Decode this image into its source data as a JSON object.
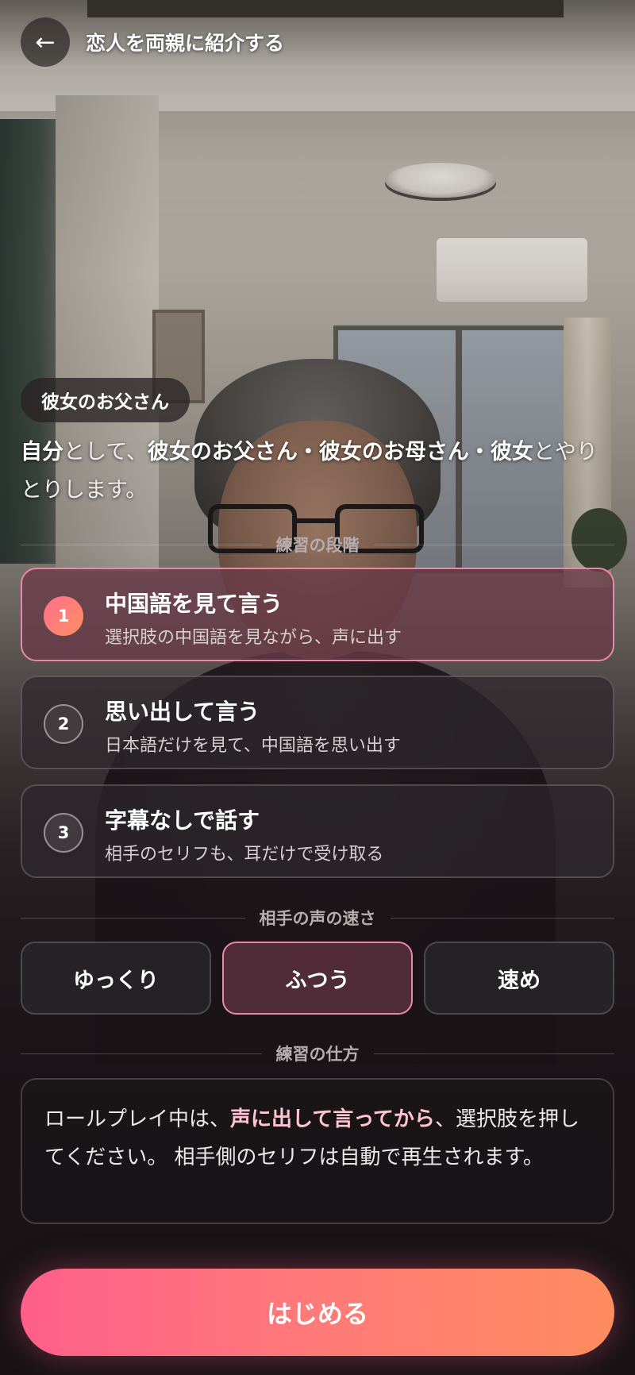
{
  "header": {
    "back_icon": "←",
    "title": "恋人を両親に紹介する"
  },
  "role_badge": "彼女のお父さん",
  "intro": {
    "self": "自分",
    "as": "として、",
    "partners": "彼女のお父さん・彼女のお母さん・彼女",
    "rest": "とやりとりします。"
  },
  "sections": {
    "steps_label": "練習の段階",
    "speed_label": "相手の声の速さ",
    "method_label": "練習の仕方"
  },
  "steps": [
    {
      "num": "1",
      "title": "中国語を見て言う",
      "subtitle": "選択肢の中国語を見ながら、声に出す",
      "selected": true
    },
    {
      "num": "2",
      "title": "思い出して言う",
      "subtitle": "日本語だけを見て、中国語を思い出す",
      "selected": false
    },
    {
      "num": "3",
      "title": "字幕なしで話す",
      "subtitle": "相手のセリフも、耳だけで受け取る",
      "selected": false
    }
  ],
  "speed": {
    "options": [
      "ゆっくり",
      "ふつう",
      "速め"
    ],
    "selected": "ふつう"
  },
  "howto": {
    "before": "ロールプレイ中は、",
    "emphasis": "声に出して言ってから",
    "after": "、選択肢を押してください。 相手側のセリフは自動で再生されます。"
  },
  "start_button": "はじめる",
  "colors": {
    "accent_start": "#ff5f8a",
    "accent_end": "#ff8c5f",
    "selected_border": "#e98aa5"
  }
}
